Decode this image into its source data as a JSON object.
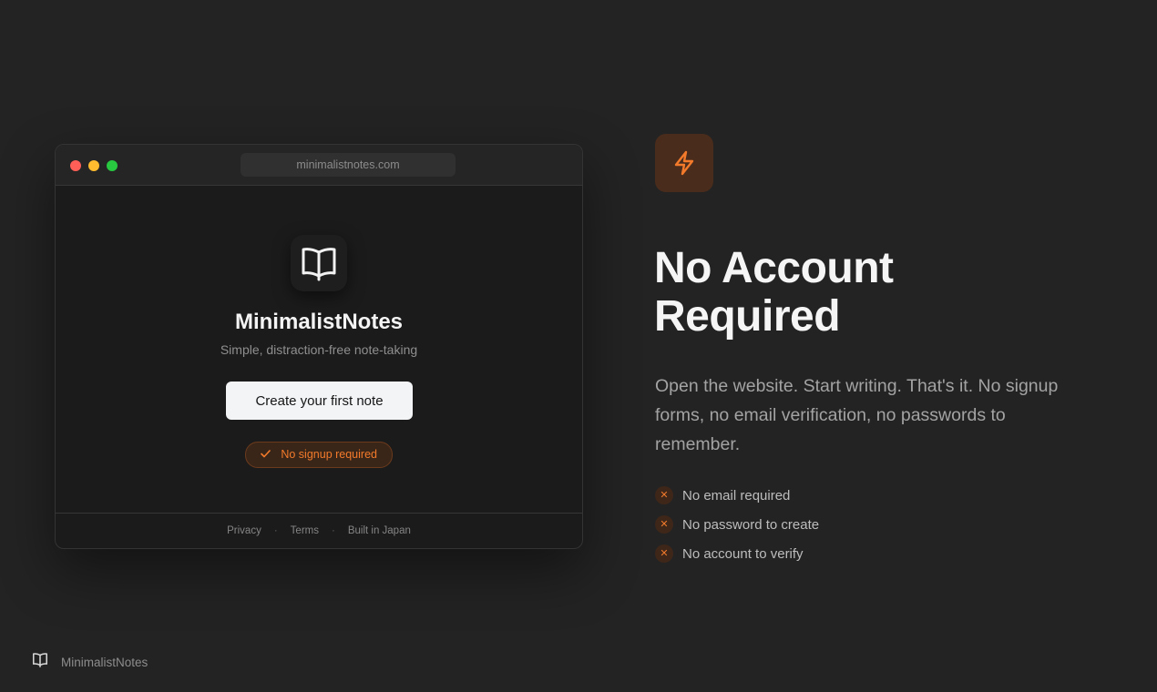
{
  "browser": {
    "url": "minimalistnotes.com",
    "app": {
      "icon": "open-book-icon",
      "title": "MinimalistNotes",
      "subtitle": "Simple, distraction-free note-taking",
      "cta_label": "Create your first note",
      "badge_label": "No signup required",
      "badge_icon": "check-icon"
    },
    "footer": {
      "links": [
        "Privacy",
        "Terms",
        "Built in Japan"
      ],
      "separator": "·"
    }
  },
  "feature": {
    "icon": "lightning-bolt-icon",
    "headline_line1": "No Account",
    "headline_line2": "Required",
    "description": "Open the website. Start writing. That's it. No signup forms, no email verification, no passwords to remember.",
    "points": [
      "No email required",
      "No password to create",
      "No account to verify"
    ],
    "point_icon": "x-icon"
  },
  "brand": {
    "icon": "open-book-icon",
    "name": "MinimalistNotes"
  },
  "colors": {
    "background": "#232323",
    "accent": "#f27a2a",
    "accent_bg": "#4a2c1c",
    "traffic_red": "#ff5f57",
    "traffic_yellow": "#febc2e",
    "traffic_green": "#28c840"
  }
}
